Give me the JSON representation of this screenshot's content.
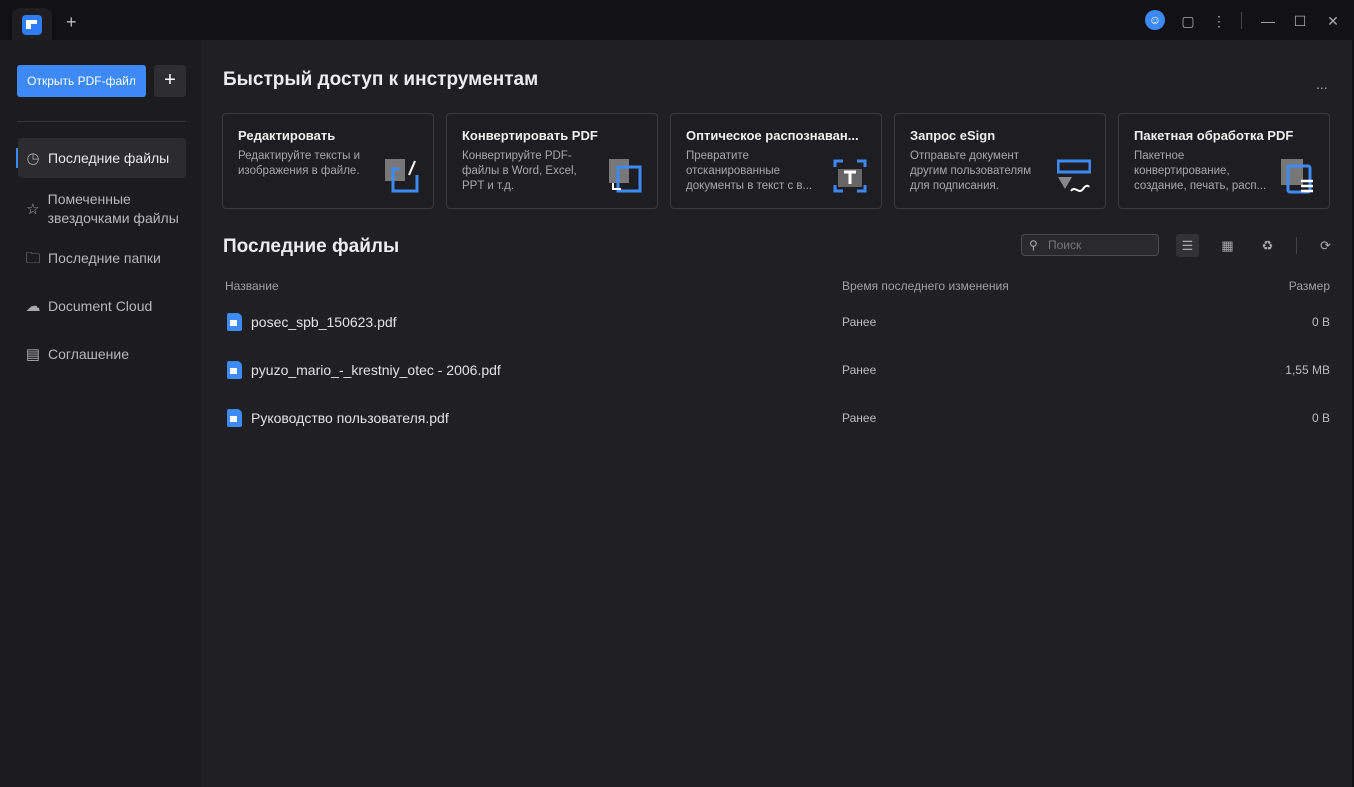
{
  "titlebar": {
    "new_tab": "+",
    "icons": [
      "user-avatar-icon",
      "feedback-icon",
      "more-vertical-icon",
      "minimize-icon",
      "maximize-icon",
      "close-icon"
    ]
  },
  "sidebar": {
    "open_button": "Открыть PDF-файл",
    "add_button": "+",
    "items": [
      {
        "label": "Последние файлы",
        "icon": "clock-icon",
        "active": true
      },
      {
        "label": "Помеченные звездочками файлы",
        "icon": "star-icon"
      },
      {
        "label": "Последние папки",
        "icon": "folder-icon"
      },
      {
        "label": "Document Cloud",
        "icon": "cloud-icon"
      },
      {
        "label": "Соглашение",
        "icon": "document-icon"
      }
    ]
  },
  "quick": {
    "title": "Быстрый доступ к инструментам",
    "more": "...",
    "cards": [
      {
        "title": "Редактировать",
        "desc": "Редактируйте тексты и изображения в файле."
      },
      {
        "title": "Конвертировать PDF",
        "desc": "Конвертируйте PDF-файлы в Word, Excel, PPT и т.д."
      },
      {
        "title": "Оптическое распознаван...",
        "desc": "Превратите отсканированные документы в текст с в..."
      },
      {
        "title": "Запрос eSign",
        "desc": "Отправьте документ другим пользователям для подписания."
      },
      {
        "title": "Пакетная обработка PDF",
        "desc": "Пакетное конвертирование, создание, печать, расп..."
      }
    ]
  },
  "recent": {
    "title": "Последние файлы",
    "search_placeholder": "Поиск",
    "columns": {
      "name": "Название",
      "modified": "Время последнего изменения",
      "size": "Размер"
    },
    "files": [
      {
        "name": "posec_spb_150623.pdf",
        "modified": "Ранее",
        "size": "0 B"
      },
      {
        "name": "pyuzo_mario_-_krestniy_otec - 2006.pdf",
        "modified": "Ранее",
        "size": "1,55 MB"
      },
      {
        "name": "Руководство пользователя.pdf",
        "modified": "Ранее",
        "size": "0 B"
      }
    ]
  },
  "colors": {
    "accent": "#3d8af7",
    "background": "#202024",
    "sidebar": "#1c1c1f"
  }
}
